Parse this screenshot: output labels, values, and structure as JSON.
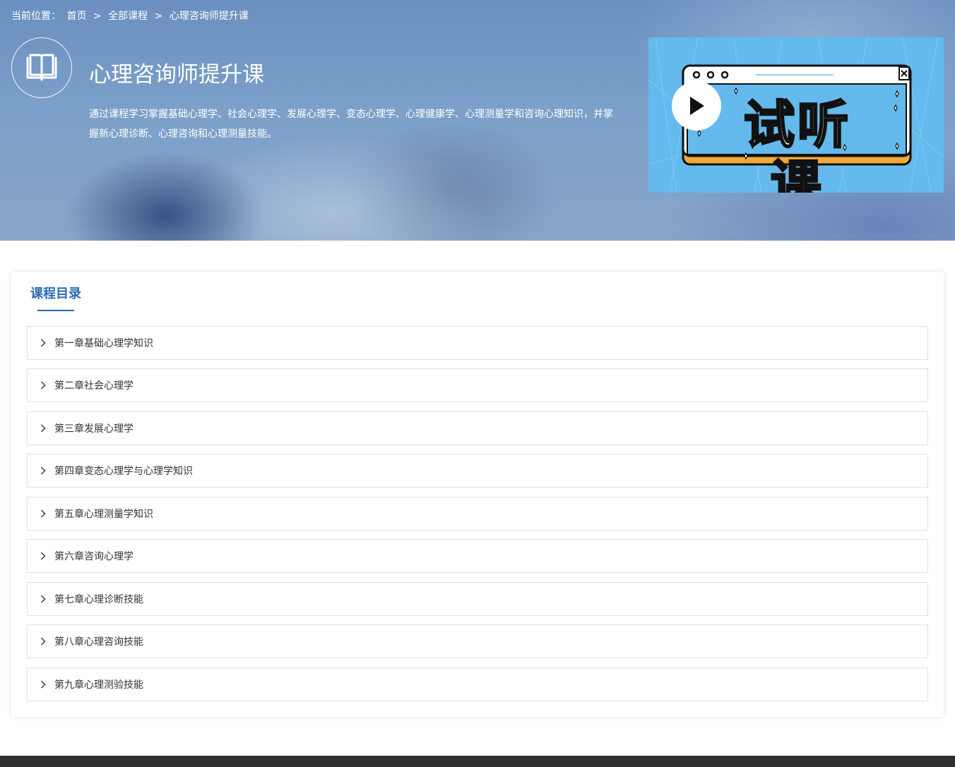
{
  "breadcrumb": {
    "prefix": "当前位置：",
    "home": "首页",
    "sep1": ">",
    "all_courses": "全部课程",
    "sep2": ">",
    "current": "心理咨询师提升课"
  },
  "course": {
    "title": "心理咨询师提升课",
    "description": "通过课程学习掌握基础心理学、社会心理学、发展心理学、变态心理学、心理健康学、心理测量学和咨询心理知识，并掌握新心理诊断、心理咨询和心理测量技能。",
    "icon": "book-icon"
  },
  "trial": {
    "label": "试听课",
    "play_icon": "play-icon",
    "colors": {
      "background": "#64b9ed",
      "window_border": "#111111",
      "frame": "#f0a93a"
    }
  },
  "catalog": {
    "title": "课程目录",
    "chapters": [
      "第一章基础心理学知识",
      "第二章社会心理学",
      "第三章发展心理学",
      "第四章变态心理学与心理学知识",
      "第五章心理测量学知识",
      "第六章咨询心理学",
      "第七章心理诊断技能",
      "第八章心理咨询技能",
      "第九章心理测验技能"
    ]
  },
  "colors": {
    "accent": "#2a6bb3",
    "footer": "#2f2f2f"
  }
}
